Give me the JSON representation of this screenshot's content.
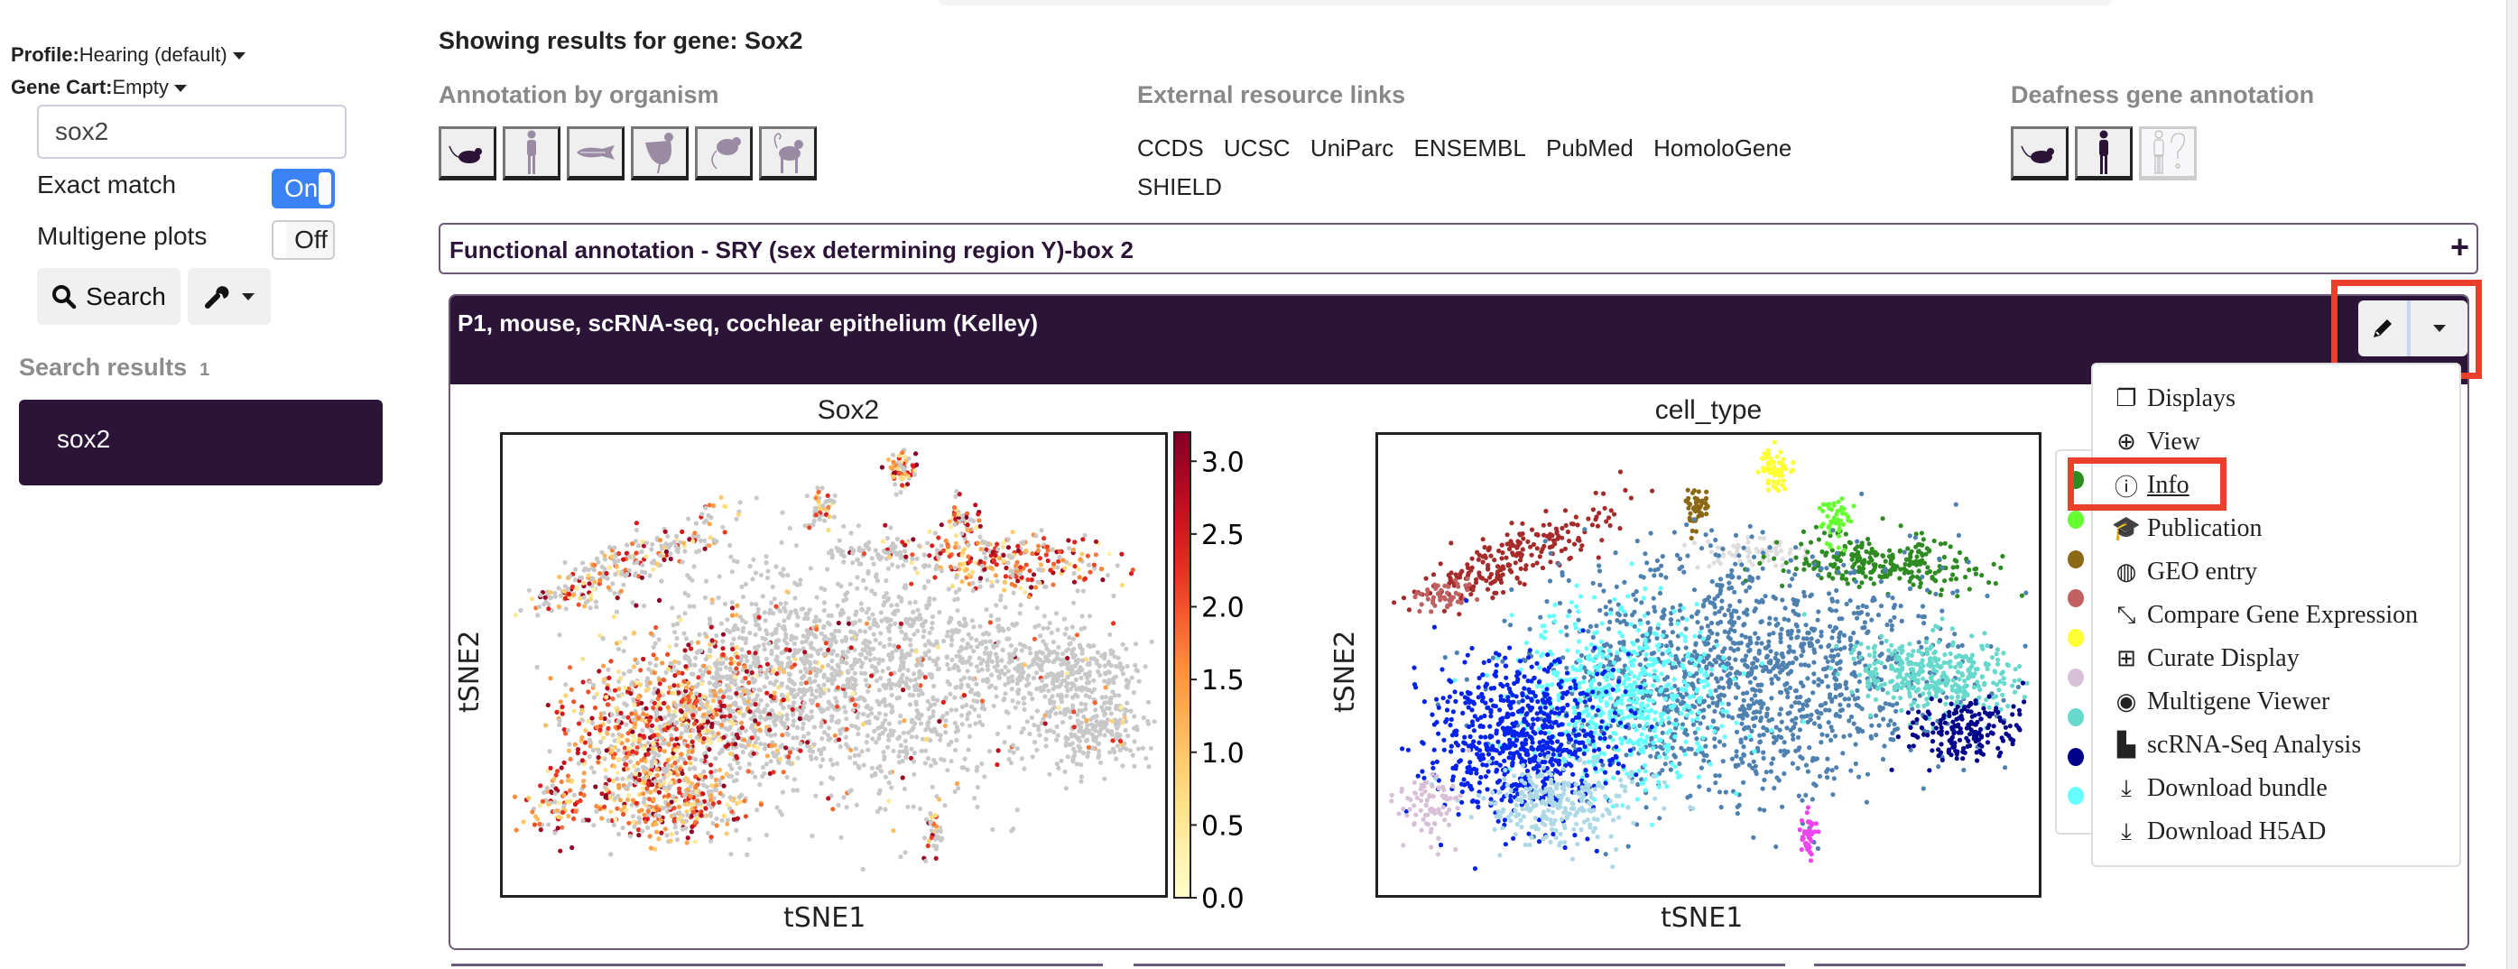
{
  "sidebar": {
    "profile_label": "Profile:",
    "profile_value": "Hearing (default)",
    "gene_cart_label": "Gene Cart:",
    "gene_cart_value": "Empty",
    "search_value": "sox2",
    "exact_match_label": "Exact match",
    "exact_match_state": "On",
    "multigene_label": "Multigene plots",
    "multigene_state": "Off",
    "search_button": "Search",
    "search_results_title": "Search results",
    "search_results_count": "1",
    "results": [
      "sox2"
    ]
  },
  "main": {
    "heading": "Showing results for gene: Sox2",
    "annotation_by_organism": "Annotation by organism",
    "organisms": [
      "mouse",
      "human",
      "zebrafish",
      "chicken",
      "rat",
      "marmoset"
    ],
    "external_links_title": "External resource links",
    "external_links": [
      "CCDS",
      "UCSC",
      "UniParc",
      "ENSEMBL",
      "PubMed",
      "HomoloGene",
      "SHIELD"
    ],
    "deafness_title": "Deafness gene annotation",
    "deafness_icons": [
      "mouse",
      "human",
      "human-unknown"
    ],
    "functional_annotation": "Functional annotation - SRY (sex determining region Y)-box 2",
    "dataset_title": "P1, mouse, scRNA-seq, cochlear epithelium (Kelley)",
    "dropdown_items": [
      {
        "icon": "clone-icon",
        "label": "Displays"
      },
      {
        "icon": "zoom-in-icon",
        "label": "View"
      },
      {
        "icon": "info-circle-icon",
        "label": "Info"
      },
      {
        "icon": "graduation-cap-icon",
        "label": "Publication"
      },
      {
        "icon": "globe-icon",
        "label": "GEO entry"
      },
      {
        "icon": "compress-arrows-icon",
        "label": "Compare Gene Expression"
      },
      {
        "icon": "plus-square-icon",
        "label": "Curate Display"
      },
      {
        "icon": "eye-icon",
        "label": "Multigene Viewer"
      },
      {
        "icon": "bar-chart-icon",
        "label": "scRNA-Seq Analysis"
      },
      {
        "icon": "download-icon",
        "label": "Download bundle"
      },
      {
        "icon": "download-icon",
        "label": "Download H5AD"
      }
    ],
    "highlighted_item": "Info"
  },
  "colors": {
    "brand": "#2c1338",
    "toggle_on": "#3b82f6",
    "highlight": "#e8402a",
    "zero_expression": "#c8c8c8"
  },
  "chart_data": [
    {
      "type": "scatter",
      "title": "Sox2",
      "xlabel": "tSNE1",
      "ylabel": "tSNE2",
      "color_scale": "YlOrRd",
      "colorbar_range": [
        0,
        3.2
      ],
      "colorbar_ticks": [
        "0.0",
        "0.5",
        "1.0",
        "1.5",
        "2.0",
        "2.5",
        "3.0"
      ],
      "grid": false
    },
    {
      "type": "scatter",
      "title": "cell_type",
      "xlabel": "tSNE1",
      "ylabel": "tSNE2",
      "legend_placement": "right",
      "legend_colors": [
        "#2e8b22",
        "#66ff33",
        "#8b6914",
        "#c06060",
        "#ffff33",
        "#d8bfd8",
        "#66d9cc",
        "#00008b",
        "#66ffff"
      ],
      "grid": false
    }
  ]
}
